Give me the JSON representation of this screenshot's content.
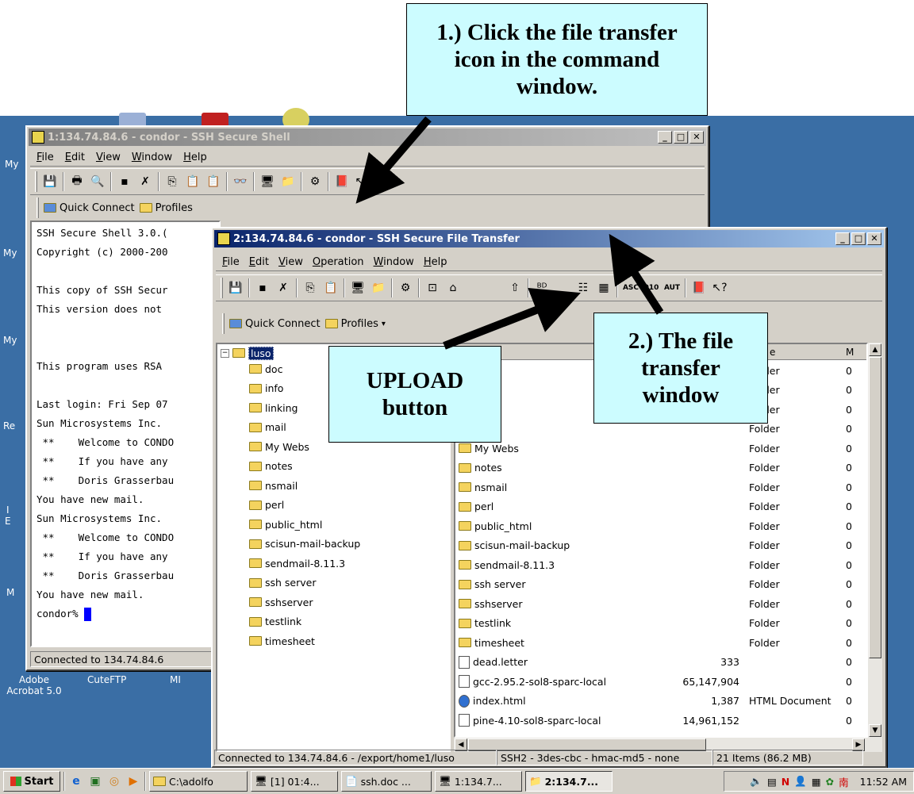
{
  "desktop": {
    "icons": [
      {
        "label": "My"
      },
      {
        "label": "My"
      },
      {
        "label": "My"
      },
      {
        "label": "Re"
      },
      {
        "label": "I"
      },
      {
        "label": "E"
      },
      {
        "label": "M"
      },
      {
        "label": "Adobe Acrobat 5.0"
      },
      {
        "label": "CuteFTP"
      },
      {
        "label": "MI"
      }
    ]
  },
  "shell_window": {
    "title": "1:134.74.84.6 - condor - SSH Secure Shell",
    "menu": [
      "File",
      "Edit",
      "View",
      "Window",
      "Help"
    ],
    "quick_connect": "Quick Connect",
    "profiles": "Profiles",
    "terminal_lines": [
      "SSH Secure Shell 3.0.(",
      "Copyright (c) 2000-200",
      "",
      "This copy of SSH Secur",
      "This version does not",
      "",
      "",
      "This program uses RSA",
      "",
      "Last login: Fri Sep 07",
      "Sun Microsystems Inc.",
      " **    Welcome to CONDO",
      " **    If you have any",
      " **    Doris Grasserbau",
      "You have new mail.",
      "Sun Microsystems Inc.",
      " **    Welcome to CONDO",
      " **    If you have any",
      " **    Doris Grasserbau",
      "You have new mail."
    ],
    "prompt": "condor% ",
    "status": "Connected to 134.74.84.6"
  },
  "sftp_window": {
    "title": "2:134.74.84.6 - condor - SSH Secure File Transfer",
    "menu": [
      "File",
      "Edit",
      "View",
      "Operation",
      "Window",
      "Help"
    ],
    "quick_connect": "Quick Connect",
    "profiles": "Profiles",
    "tree_root": "luso",
    "tree_items": [
      "doc",
      "info",
      "linking",
      "mail",
      "My Webs",
      "notes",
      "nsmail",
      "perl",
      "public_html",
      "scisun-mail-backup",
      "sendmail-8.11.3",
      "ssh server",
      "sshserver",
      "testlink",
      "timesheet"
    ],
    "list_header": {
      "type": "e",
      "mod": "M"
    },
    "list_rows": [
      {
        "name": "",
        "size": "",
        "type": "Folder",
        "mod": "0",
        "kind": "folder"
      },
      {
        "name": "",
        "size": "",
        "type": "Folder",
        "mod": "0",
        "kind": "folder"
      },
      {
        "name": "g",
        "size": "",
        "type": "Folder",
        "mod": "0",
        "kind": "folder"
      },
      {
        "name": "",
        "size": "",
        "type": "Folder",
        "mod": "0",
        "kind": "folder"
      },
      {
        "name": "My Webs",
        "size": "",
        "type": "Folder",
        "mod": "0",
        "kind": "folder"
      },
      {
        "name": "notes",
        "size": "",
        "type": "Folder",
        "mod": "0",
        "kind": "folder"
      },
      {
        "name": "nsmail",
        "size": "",
        "type": "Folder",
        "mod": "0",
        "kind": "folder"
      },
      {
        "name": "perl",
        "size": "",
        "type": "Folder",
        "mod": "0",
        "kind": "folder"
      },
      {
        "name": "public_html",
        "size": "",
        "type": "Folder",
        "mod": "0",
        "kind": "folder"
      },
      {
        "name": "scisun-mail-backup",
        "size": "",
        "type": "Folder",
        "mod": "0",
        "kind": "folder"
      },
      {
        "name": "sendmail-8.11.3",
        "size": "",
        "type": "Folder",
        "mod": "0",
        "kind": "folder"
      },
      {
        "name": "ssh server",
        "size": "",
        "type": "Folder",
        "mod": "0",
        "kind": "folder"
      },
      {
        "name": "sshserver",
        "size": "",
        "type": "Folder",
        "mod": "0",
        "kind": "folder"
      },
      {
        "name": "testlink",
        "size": "",
        "type": "Folder",
        "mod": "0",
        "kind": "folder"
      },
      {
        "name": "timesheet",
        "size": "",
        "type": "Folder",
        "mod": "0",
        "kind": "folder"
      },
      {
        "name": "dead.letter",
        "size": "333",
        "type": "",
        "mod": "0",
        "kind": "file"
      },
      {
        "name": "gcc-2.95.2-sol8-sparc-local",
        "size": "65,147,904",
        "type": "",
        "mod": "0",
        "kind": "file"
      },
      {
        "name": "index.html",
        "size": "1,387",
        "type": "HTML Document",
        "mod": "0",
        "kind": "html"
      },
      {
        "name": "pine-4.10-sol8-sparc-local",
        "size": "14,961,152",
        "type": "",
        "mod": "0",
        "kind": "file"
      }
    ],
    "status_path": "Connected to 134.74.84.6 - /export/home1/luso",
    "status_cipher": "SSH2 - 3des-cbc - hmac-md5 - none",
    "status_items": "21 Items (86.2 MB)"
  },
  "callouts": {
    "c1": "1.) Click the file transfer icon in the command window.",
    "c2": "2.) The file transfer window",
    "c3": "UPLOAD button"
  },
  "taskbar": {
    "start": "Start",
    "tasks": [
      "C:\\adolfo",
      "[1] 01:4...",
      "ssh.doc ...",
      "1:134.7...",
      "2:134.7..."
    ],
    "clock": "11:52 AM"
  }
}
